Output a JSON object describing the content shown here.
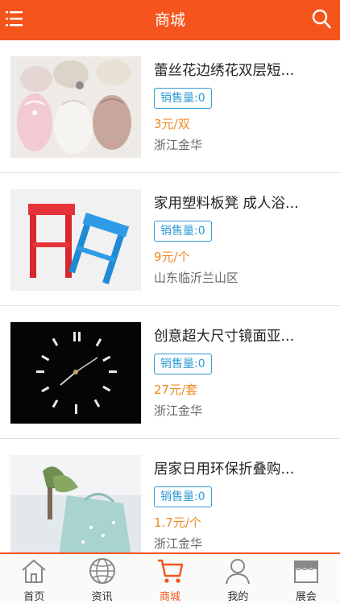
{
  "header": {
    "title": "商城"
  },
  "products": [
    {
      "name": "蕾丝花边绣花双层短...",
      "sales_label": "销售量:",
      "sales_count": "0",
      "price": "3元/双",
      "location": "浙江金华"
    },
    {
      "name": "家用塑料板凳 成人浴...",
      "sales_label": "销售量:",
      "sales_count": "0",
      "price": "9元/个",
      "location": "山东临沂兰山区"
    },
    {
      "name": "创意超大尺寸镜面亚...",
      "sales_label": "销售量:",
      "sales_count": "0",
      "price": "27元/套",
      "location": "浙江金华"
    },
    {
      "name": "居家日用环保折叠购...",
      "sales_label": "销售量:",
      "sales_count": "0",
      "price": "1.7元/个",
      "location": "浙江金华"
    }
  ],
  "tabbar": {
    "items": [
      {
        "label": "首页",
        "icon": "home-icon"
      },
      {
        "label": "资讯",
        "icon": "globe-icon"
      },
      {
        "label": "商城",
        "icon": "cart-icon",
        "active": true
      },
      {
        "label": "我的",
        "icon": "user-icon"
      },
      {
        "label": "展会",
        "icon": "store-icon"
      }
    ]
  },
  "colors": {
    "brand": "#f5541c",
    "sales_border": "#2e9bd6",
    "price": "#f08a24"
  }
}
